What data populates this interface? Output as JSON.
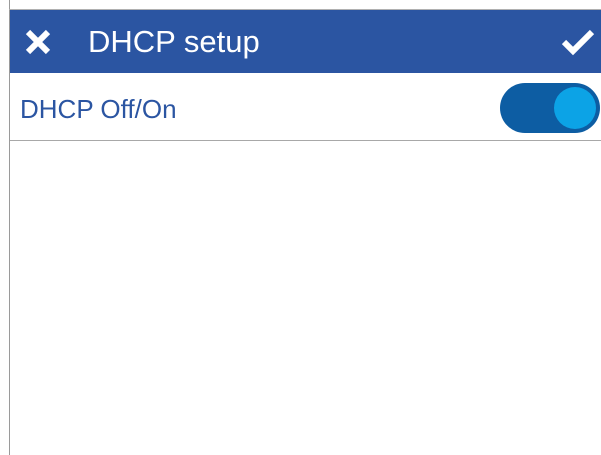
{
  "header": {
    "title": "DHCP setup",
    "close_icon": "close-icon",
    "confirm_icon": "checkmark-icon"
  },
  "settings": {
    "dhcp": {
      "label": "DHCP Off/On",
      "enabled": true
    }
  },
  "colors": {
    "header_bg": "#2b55a2",
    "label_text": "#2b55a2",
    "toggle_track": "#0d5da3",
    "toggle_knob": "#0ca3e6",
    "divider": "#a8a8a8"
  }
}
